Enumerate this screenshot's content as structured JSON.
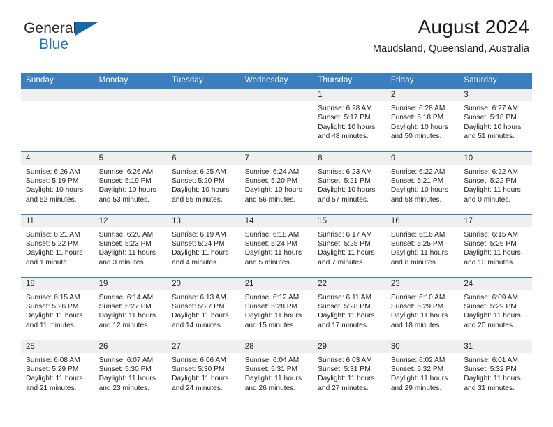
{
  "brand": {
    "name_part1": "General",
    "name_part2": "Blue",
    "flag_icon": "flag-triangle-icon"
  },
  "header": {
    "title": "August 2024",
    "subtitle": "Maudsland, Queensland, Australia"
  },
  "calendar": {
    "weekday_headers": [
      "Sunday",
      "Monday",
      "Tuesday",
      "Wednesday",
      "Thursday",
      "Friday",
      "Saturday"
    ],
    "accent_color": "#3c7fc1",
    "daynum_bg": "#efefef",
    "weeks": [
      [
        {
          "day": "",
          "empty": true
        },
        {
          "day": "",
          "empty": true
        },
        {
          "day": "",
          "empty": true
        },
        {
          "day": "",
          "empty": true
        },
        {
          "day": "1",
          "sunrise": "Sunrise: 6:28 AM",
          "sunset": "Sunset: 5:17 PM",
          "daylight_line1": "Daylight: 10 hours",
          "daylight_line2": "and 48 minutes."
        },
        {
          "day": "2",
          "sunrise": "Sunrise: 6:28 AM",
          "sunset": "Sunset: 5:18 PM",
          "daylight_line1": "Daylight: 10 hours",
          "daylight_line2": "and 50 minutes."
        },
        {
          "day": "3",
          "sunrise": "Sunrise: 6:27 AM",
          "sunset": "Sunset: 5:18 PM",
          "daylight_line1": "Daylight: 10 hours",
          "daylight_line2": "and 51 minutes."
        }
      ],
      [
        {
          "day": "4",
          "sunrise": "Sunrise: 6:26 AM",
          "sunset": "Sunset: 5:19 PM",
          "daylight_line1": "Daylight: 10 hours",
          "daylight_line2": "and 52 minutes."
        },
        {
          "day": "5",
          "sunrise": "Sunrise: 6:26 AM",
          "sunset": "Sunset: 5:19 PM",
          "daylight_line1": "Daylight: 10 hours",
          "daylight_line2": "and 53 minutes."
        },
        {
          "day": "6",
          "sunrise": "Sunrise: 6:25 AM",
          "sunset": "Sunset: 5:20 PM",
          "daylight_line1": "Daylight: 10 hours",
          "daylight_line2": "and 55 minutes."
        },
        {
          "day": "7",
          "sunrise": "Sunrise: 6:24 AM",
          "sunset": "Sunset: 5:20 PM",
          "daylight_line1": "Daylight: 10 hours",
          "daylight_line2": "and 56 minutes."
        },
        {
          "day": "8",
          "sunrise": "Sunrise: 6:23 AM",
          "sunset": "Sunset: 5:21 PM",
          "daylight_line1": "Daylight: 10 hours",
          "daylight_line2": "and 57 minutes."
        },
        {
          "day": "9",
          "sunrise": "Sunrise: 6:22 AM",
          "sunset": "Sunset: 5:21 PM",
          "daylight_line1": "Daylight: 10 hours",
          "daylight_line2": "and 58 minutes."
        },
        {
          "day": "10",
          "sunrise": "Sunrise: 6:22 AM",
          "sunset": "Sunset: 5:22 PM",
          "daylight_line1": "Daylight: 11 hours",
          "daylight_line2": "and 0 minutes."
        }
      ],
      [
        {
          "day": "11",
          "sunrise": "Sunrise: 6:21 AM",
          "sunset": "Sunset: 5:22 PM",
          "daylight_line1": "Daylight: 11 hours",
          "daylight_line2": "and 1 minute."
        },
        {
          "day": "12",
          "sunrise": "Sunrise: 6:20 AM",
          "sunset": "Sunset: 5:23 PM",
          "daylight_line1": "Daylight: 11 hours",
          "daylight_line2": "and 3 minutes."
        },
        {
          "day": "13",
          "sunrise": "Sunrise: 6:19 AM",
          "sunset": "Sunset: 5:24 PM",
          "daylight_line1": "Daylight: 11 hours",
          "daylight_line2": "and 4 minutes."
        },
        {
          "day": "14",
          "sunrise": "Sunrise: 6:18 AM",
          "sunset": "Sunset: 5:24 PM",
          "daylight_line1": "Daylight: 11 hours",
          "daylight_line2": "and 5 minutes."
        },
        {
          "day": "15",
          "sunrise": "Sunrise: 6:17 AM",
          "sunset": "Sunset: 5:25 PM",
          "daylight_line1": "Daylight: 11 hours",
          "daylight_line2": "and 7 minutes."
        },
        {
          "day": "16",
          "sunrise": "Sunrise: 6:16 AM",
          "sunset": "Sunset: 5:25 PM",
          "daylight_line1": "Daylight: 11 hours",
          "daylight_line2": "and 8 minutes."
        },
        {
          "day": "17",
          "sunrise": "Sunrise: 6:15 AM",
          "sunset": "Sunset: 5:26 PM",
          "daylight_line1": "Daylight: 11 hours",
          "daylight_line2": "and 10 minutes."
        }
      ],
      [
        {
          "day": "18",
          "sunrise": "Sunrise: 6:15 AM",
          "sunset": "Sunset: 5:26 PM",
          "daylight_line1": "Daylight: 11 hours",
          "daylight_line2": "and 11 minutes."
        },
        {
          "day": "19",
          "sunrise": "Sunrise: 6:14 AM",
          "sunset": "Sunset: 5:27 PM",
          "daylight_line1": "Daylight: 11 hours",
          "daylight_line2": "and 12 minutes."
        },
        {
          "day": "20",
          "sunrise": "Sunrise: 6:13 AM",
          "sunset": "Sunset: 5:27 PM",
          "daylight_line1": "Daylight: 11 hours",
          "daylight_line2": "and 14 minutes."
        },
        {
          "day": "21",
          "sunrise": "Sunrise: 6:12 AM",
          "sunset": "Sunset: 5:28 PM",
          "daylight_line1": "Daylight: 11 hours",
          "daylight_line2": "and 15 minutes."
        },
        {
          "day": "22",
          "sunrise": "Sunrise: 6:11 AM",
          "sunset": "Sunset: 5:28 PM",
          "daylight_line1": "Daylight: 11 hours",
          "daylight_line2": "and 17 minutes."
        },
        {
          "day": "23",
          "sunrise": "Sunrise: 6:10 AM",
          "sunset": "Sunset: 5:29 PM",
          "daylight_line1": "Daylight: 11 hours",
          "daylight_line2": "and 18 minutes."
        },
        {
          "day": "24",
          "sunrise": "Sunrise: 6:09 AM",
          "sunset": "Sunset: 5:29 PM",
          "daylight_line1": "Daylight: 11 hours",
          "daylight_line2": "and 20 minutes."
        }
      ],
      [
        {
          "day": "25",
          "sunrise": "Sunrise: 6:08 AM",
          "sunset": "Sunset: 5:29 PM",
          "daylight_line1": "Daylight: 11 hours",
          "daylight_line2": "and 21 minutes."
        },
        {
          "day": "26",
          "sunrise": "Sunrise: 6:07 AM",
          "sunset": "Sunset: 5:30 PM",
          "daylight_line1": "Daylight: 11 hours",
          "daylight_line2": "and 23 minutes."
        },
        {
          "day": "27",
          "sunrise": "Sunrise: 6:06 AM",
          "sunset": "Sunset: 5:30 PM",
          "daylight_line1": "Daylight: 11 hours",
          "daylight_line2": "and 24 minutes."
        },
        {
          "day": "28",
          "sunrise": "Sunrise: 6:04 AM",
          "sunset": "Sunset: 5:31 PM",
          "daylight_line1": "Daylight: 11 hours",
          "daylight_line2": "and 26 minutes."
        },
        {
          "day": "29",
          "sunrise": "Sunrise: 6:03 AM",
          "sunset": "Sunset: 5:31 PM",
          "daylight_line1": "Daylight: 11 hours",
          "daylight_line2": "and 27 minutes."
        },
        {
          "day": "30",
          "sunrise": "Sunrise: 6:02 AM",
          "sunset": "Sunset: 5:32 PM",
          "daylight_line1": "Daylight: 11 hours",
          "daylight_line2": "and 29 minutes."
        },
        {
          "day": "31",
          "sunrise": "Sunrise: 6:01 AM",
          "sunset": "Sunset: 5:32 PM",
          "daylight_line1": "Daylight: 11 hours",
          "daylight_line2": "and 31 minutes."
        }
      ]
    ]
  }
}
